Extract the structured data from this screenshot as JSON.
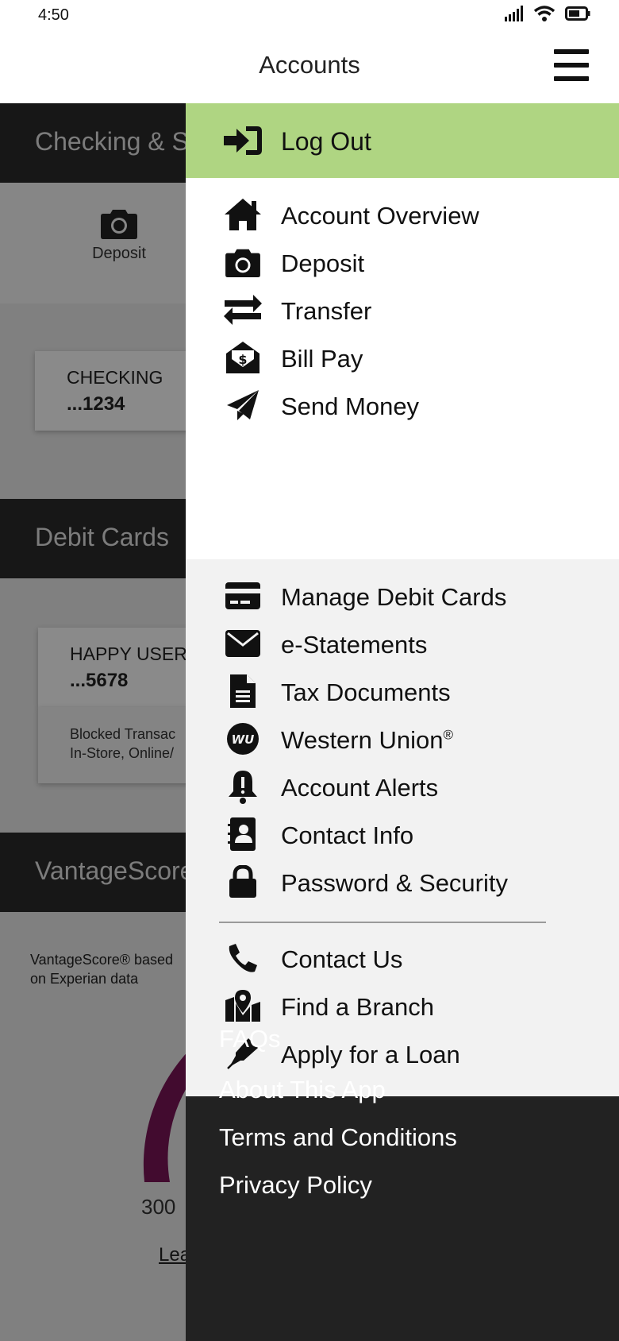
{
  "status_bar": {
    "time": "4:50"
  },
  "header": {
    "title": "Accounts"
  },
  "background": {
    "section_checking": "Checking & S",
    "deposit_label": "Deposit",
    "checking_card": {
      "name": "CHECKING",
      "number": "...1234"
    },
    "section_debit": "Debit Cards",
    "debit_card": {
      "name": "HAPPY USER",
      "number": "...5678",
      "blocked_line1": "Blocked Transac",
      "blocked_line2": "In-Store, Online/"
    },
    "section_vantage": "VantageScore",
    "vantage_note_line1": "VantageScore® based",
    "vantage_note_line2": "on Experian data",
    "gauge_min": "300",
    "learn_link": "Lea"
  },
  "drawer": {
    "logout_label": "Log Out",
    "primary_items": [
      {
        "label": "Account Overview",
        "icon": "home-icon"
      },
      {
        "label": "Deposit",
        "icon": "camera-icon"
      },
      {
        "label": "Transfer",
        "icon": "transfer-arrows-icon"
      },
      {
        "label": "Bill Pay",
        "icon": "envelope-dollar-icon"
      },
      {
        "label": "Send Money",
        "icon": "paper-plane-icon"
      }
    ],
    "secondary_items": [
      {
        "label": "Manage Debit Cards",
        "icon": "credit-card-icon"
      },
      {
        "label": "e-Statements",
        "icon": "envelope-icon"
      },
      {
        "label": "Tax Documents",
        "icon": "document-icon"
      },
      {
        "label": "Western Union",
        "label_mark": "®",
        "icon": "western-union-icon"
      },
      {
        "label": "Account Alerts",
        "icon": "alert-bell-icon"
      },
      {
        "label": "Contact Info",
        "icon": "contact-book-icon"
      },
      {
        "label": "Password & Security",
        "icon": "lock-icon"
      },
      {
        "label": "Contact Us",
        "icon": "phone-icon"
      },
      {
        "label": "Find a Branch",
        "icon": "map-pin-icon"
      },
      {
        "label": "Apply for a Loan",
        "icon": "pen-icon"
      }
    ],
    "footer_links": [
      "FAQs",
      "About This App",
      "Terms and Conditions",
      "Privacy Policy"
    ]
  },
  "colors": {
    "logout_bg": "#afd582",
    "drawer_dark": "#222222",
    "menu_gray": "#f2f2f2",
    "section_dark": "#2b2b2b"
  }
}
